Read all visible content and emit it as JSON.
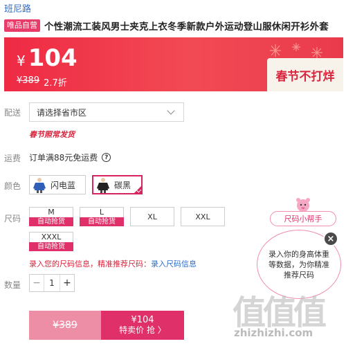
{
  "store": {
    "brand": "班尼路"
  },
  "product": {
    "tag": "唯品自营",
    "title": "个性潮流工装风男士夹克上衣冬季新款户外运动登山服休闲开衫外套"
  },
  "price": {
    "currency": "¥",
    "current": "104",
    "original": "¥389",
    "discount": "2.7折",
    "festival_label": "春节不打烊"
  },
  "shipping_area": {
    "label": "配送",
    "placeholder": "请选择省市区",
    "note": "春节照常发货"
  },
  "freight": {
    "label": "运费",
    "text": "订单满88元免运费",
    "help_icon": "?"
  },
  "colors": {
    "label": "颜色",
    "options": [
      {
        "name": "闪电蓝",
        "selected": false,
        "swatch": "#2f5fb8"
      },
      {
        "name": "碳黑",
        "selected": true,
        "swatch": "#222222"
      }
    ]
  },
  "sizes": {
    "label": "尺码",
    "options": [
      {
        "size": "M",
        "status": "自动抢货"
      },
      {
        "size": "L",
        "status": "自动抢货"
      },
      {
        "size": "XL",
        "status": ""
      },
      {
        "size": "XXL",
        "status": ""
      },
      {
        "size": "XXXL",
        "status": "自动抢货"
      }
    ],
    "recommend_text": "录入您的尺码信息，精准推荐尺码：",
    "recommend_link": "录入尺码信息"
  },
  "quantity": {
    "label": "数量",
    "value": "1",
    "minus": "−",
    "plus": "+"
  },
  "buy": {
    "original_price": "¥389",
    "sale_price": "¥104",
    "action_label": "特卖价 抢 〉"
  },
  "size_helper": {
    "label": "尺码小帮手",
    "bubble_text": "录入你的身高体重等数据，为你精准推荐尺码",
    "close": "×"
  },
  "watermark": {
    "glyphs": "值值值",
    "url": "zhizhizhi.com"
  },
  "colors_theme": {
    "accent": "#e0306a",
    "banner": "#ef2a44",
    "link": "#2f6cc6"
  }
}
